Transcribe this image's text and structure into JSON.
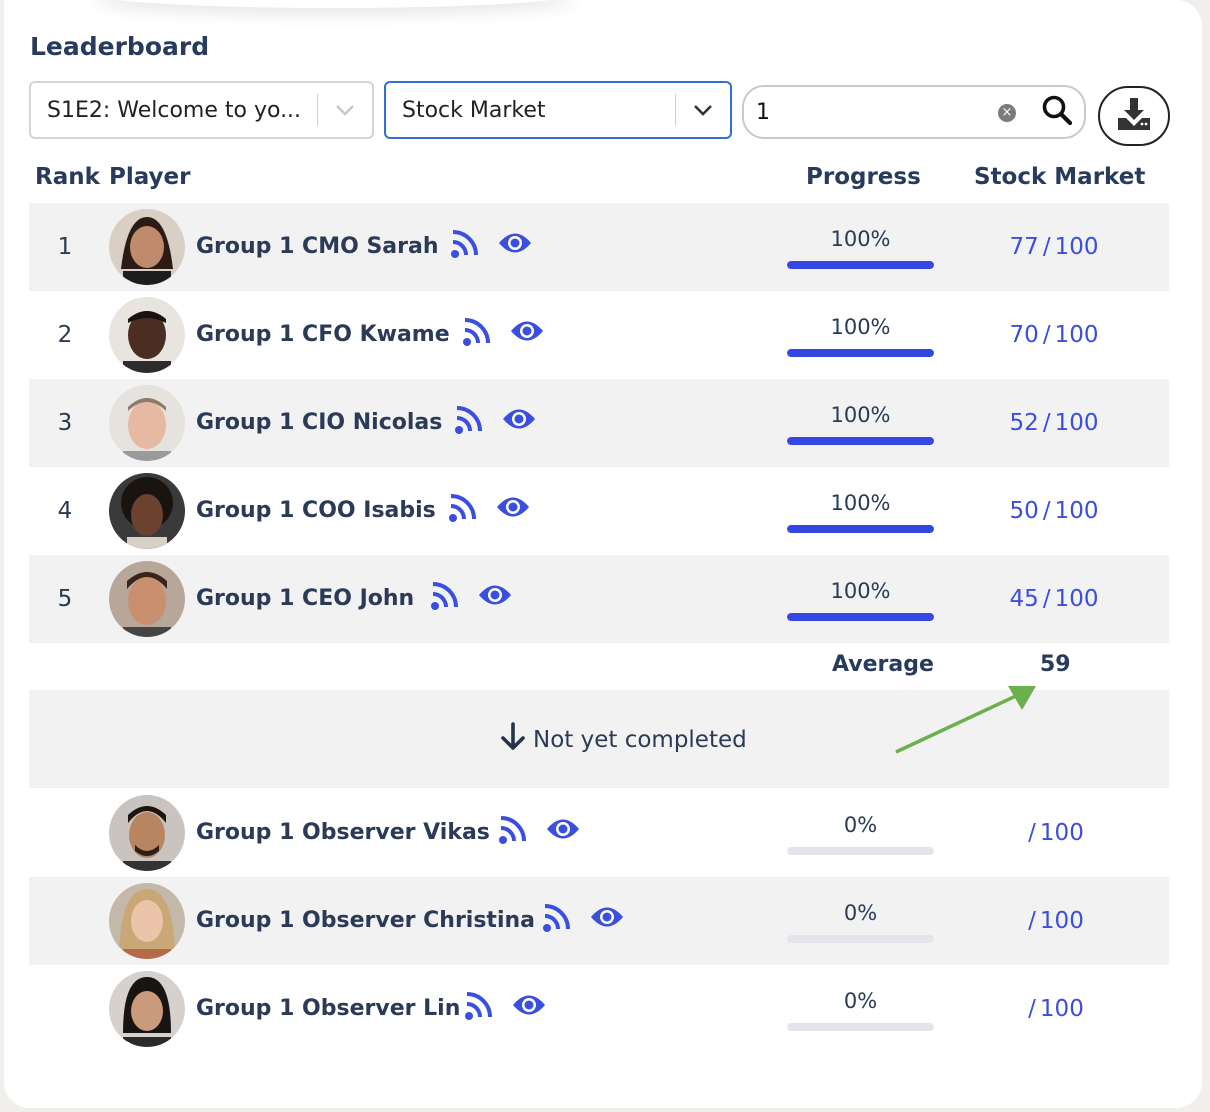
{
  "title": "Leaderboard",
  "filters": {
    "episode_select": "S1E2: Welcome to yo...",
    "category_select": "Stock Market",
    "search_value": "1",
    "search_clear": "×"
  },
  "headers": {
    "rank": "Rank",
    "player": "Player",
    "progress": "Progress",
    "score": "Stock Market"
  },
  "completed": [
    {
      "rank": "1",
      "name": "Group 1 CMO Sarah",
      "progress_text": "100%",
      "progress": 1.0,
      "score": "77",
      "max": "100"
    },
    {
      "rank": "2",
      "name": "Group 1 CFO Kwame",
      "progress_text": "100%",
      "progress": 1.0,
      "score": "70",
      "max": "100"
    },
    {
      "rank": "3",
      "name": "Group 1 CIO Nicolas",
      "progress_text": "100%",
      "progress": 1.0,
      "score": "52",
      "max": "100"
    },
    {
      "rank": "4",
      "name": "Group 1 COO Isabis",
      "progress_text": "100%",
      "progress": 1.0,
      "score": "50",
      "max": "100"
    },
    {
      "rank": "5",
      "name": "Group 1 CEO John",
      "progress_text": "100%",
      "progress": 1.0,
      "score": "45",
      "max": "100"
    }
  ],
  "average": {
    "label": "Average",
    "value": "59"
  },
  "not_completed_label": "Not yet completed",
  "not_completed": [
    {
      "name": "Group 1 Observer Vikas",
      "progress_text": "0%",
      "progress": 0.0,
      "score": "",
      "max": "100"
    },
    {
      "name": "Group 1 Observer Christina",
      "progress_text": "0%",
      "progress": 0.0,
      "score": "",
      "max": "100"
    },
    {
      "name": "Group 1 Observer Lin",
      "progress_text": "0%",
      "progress": 0.0,
      "score": "",
      "max": "100"
    }
  ],
  "colors": {
    "accent": "#3447e2",
    "title": "#283b5c",
    "row_shade": "#f2f2f2",
    "annotation_arrow": "#6ab04c"
  },
  "icons": [
    "chevron-down-icon",
    "search-icon",
    "clear-icon",
    "download-icon",
    "feed-icon",
    "eye-icon",
    "arrow-down-icon"
  ]
}
